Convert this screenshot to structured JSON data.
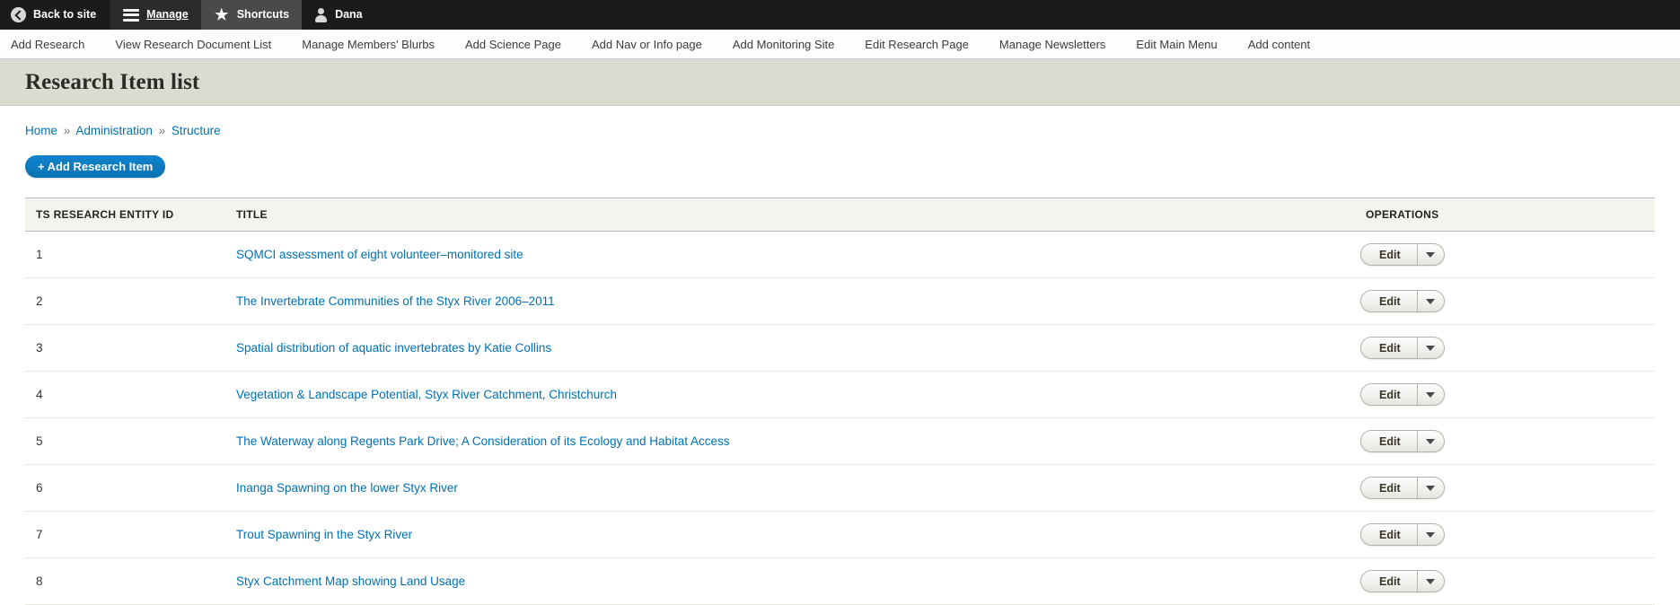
{
  "toolbar": {
    "back_label": "Back to site",
    "manage_label": "Manage",
    "shortcuts_label": "Shortcuts",
    "user_label": "Dana"
  },
  "shortcuts": [
    {
      "label": "Add Research"
    },
    {
      "label": "View Research Document List"
    },
    {
      "label": "Manage Members' Blurbs"
    },
    {
      "label": "Add Science Page"
    },
    {
      "label": "Add Nav or Info page"
    },
    {
      "label": "Add Monitoring Site"
    },
    {
      "label": "Edit Research Page"
    },
    {
      "label": "Manage Newsletters"
    },
    {
      "label": "Edit Main Menu"
    },
    {
      "label": "Add content"
    }
  ],
  "page": {
    "title": "Research Item list",
    "add_button": "Add Research Item",
    "add_button_plus": "+"
  },
  "breadcrumb": {
    "items": [
      {
        "label": "Home"
      },
      {
        "label": "Administration"
      },
      {
        "label": "Structure"
      }
    ],
    "separator": "»"
  },
  "table": {
    "columns": {
      "id": "TS RESEARCH ENTITY ID",
      "title": "TITLE",
      "operations": "OPERATIONS"
    },
    "edit_label": "Edit",
    "rows": [
      {
        "id": "1",
        "title": "SQMCI assessment of eight volunteer–monitored site"
      },
      {
        "id": "2",
        "title": "The Invertebrate Communities of the Styx River 2006–2011"
      },
      {
        "id": "3",
        "title": "Spatial distribution of aquatic invertebrates by Katie Collins"
      },
      {
        "id": "4",
        "title": "Vegetation & Landscape Potential, Styx River Catchment, Christchurch"
      },
      {
        "id": "5",
        "title": "The Waterway along Regents Park Drive; A Consideration of its Ecology and Habitat Access"
      },
      {
        "id": "6",
        "title": "Inanga Spawning on the lower Styx River"
      },
      {
        "id": "7",
        "title": "Trout Spawning in the Styx River"
      },
      {
        "id": "8",
        "title": "Styx Catchment Map showing Land Usage"
      }
    ]
  },
  "colors": {
    "link": "#0071b3",
    "button": "#0c7ac0",
    "toolbar_bg": "#1b1b1b",
    "header_band": "#dbdbd2"
  }
}
